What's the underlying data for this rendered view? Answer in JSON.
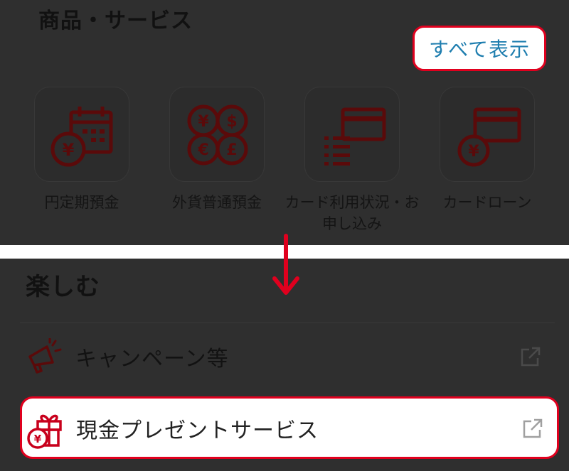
{
  "products": {
    "title": "商品・サービス",
    "show_all_label": "すべて表示",
    "items": [
      {
        "label": "円定期預金",
        "icon": "calendar-yen-icon"
      },
      {
        "label": "外貨普通預金",
        "icon": "foreign-currency-icon"
      },
      {
        "label": "カード利用状況・お申し込み",
        "icon": "card-list-icon"
      },
      {
        "label": "カードローン",
        "icon": "card-loan-icon"
      }
    ]
  },
  "enjoy": {
    "title": "楽しむ",
    "items": [
      {
        "label": "キャンペーン等",
        "icon": "megaphone-icon",
        "external": true
      },
      {
        "label": "現金プレゼントサービス",
        "icon": "gift-yen-icon",
        "external": true,
        "highlighted": true
      }
    ]
  },
  "colors": {
    "accent_red": "#e0001e",
    "icon_dark_red": "#5a0a0a",
    "link_blue": "#1f7eaf",
    "overlay": "#2f2f2f"
  }
}
